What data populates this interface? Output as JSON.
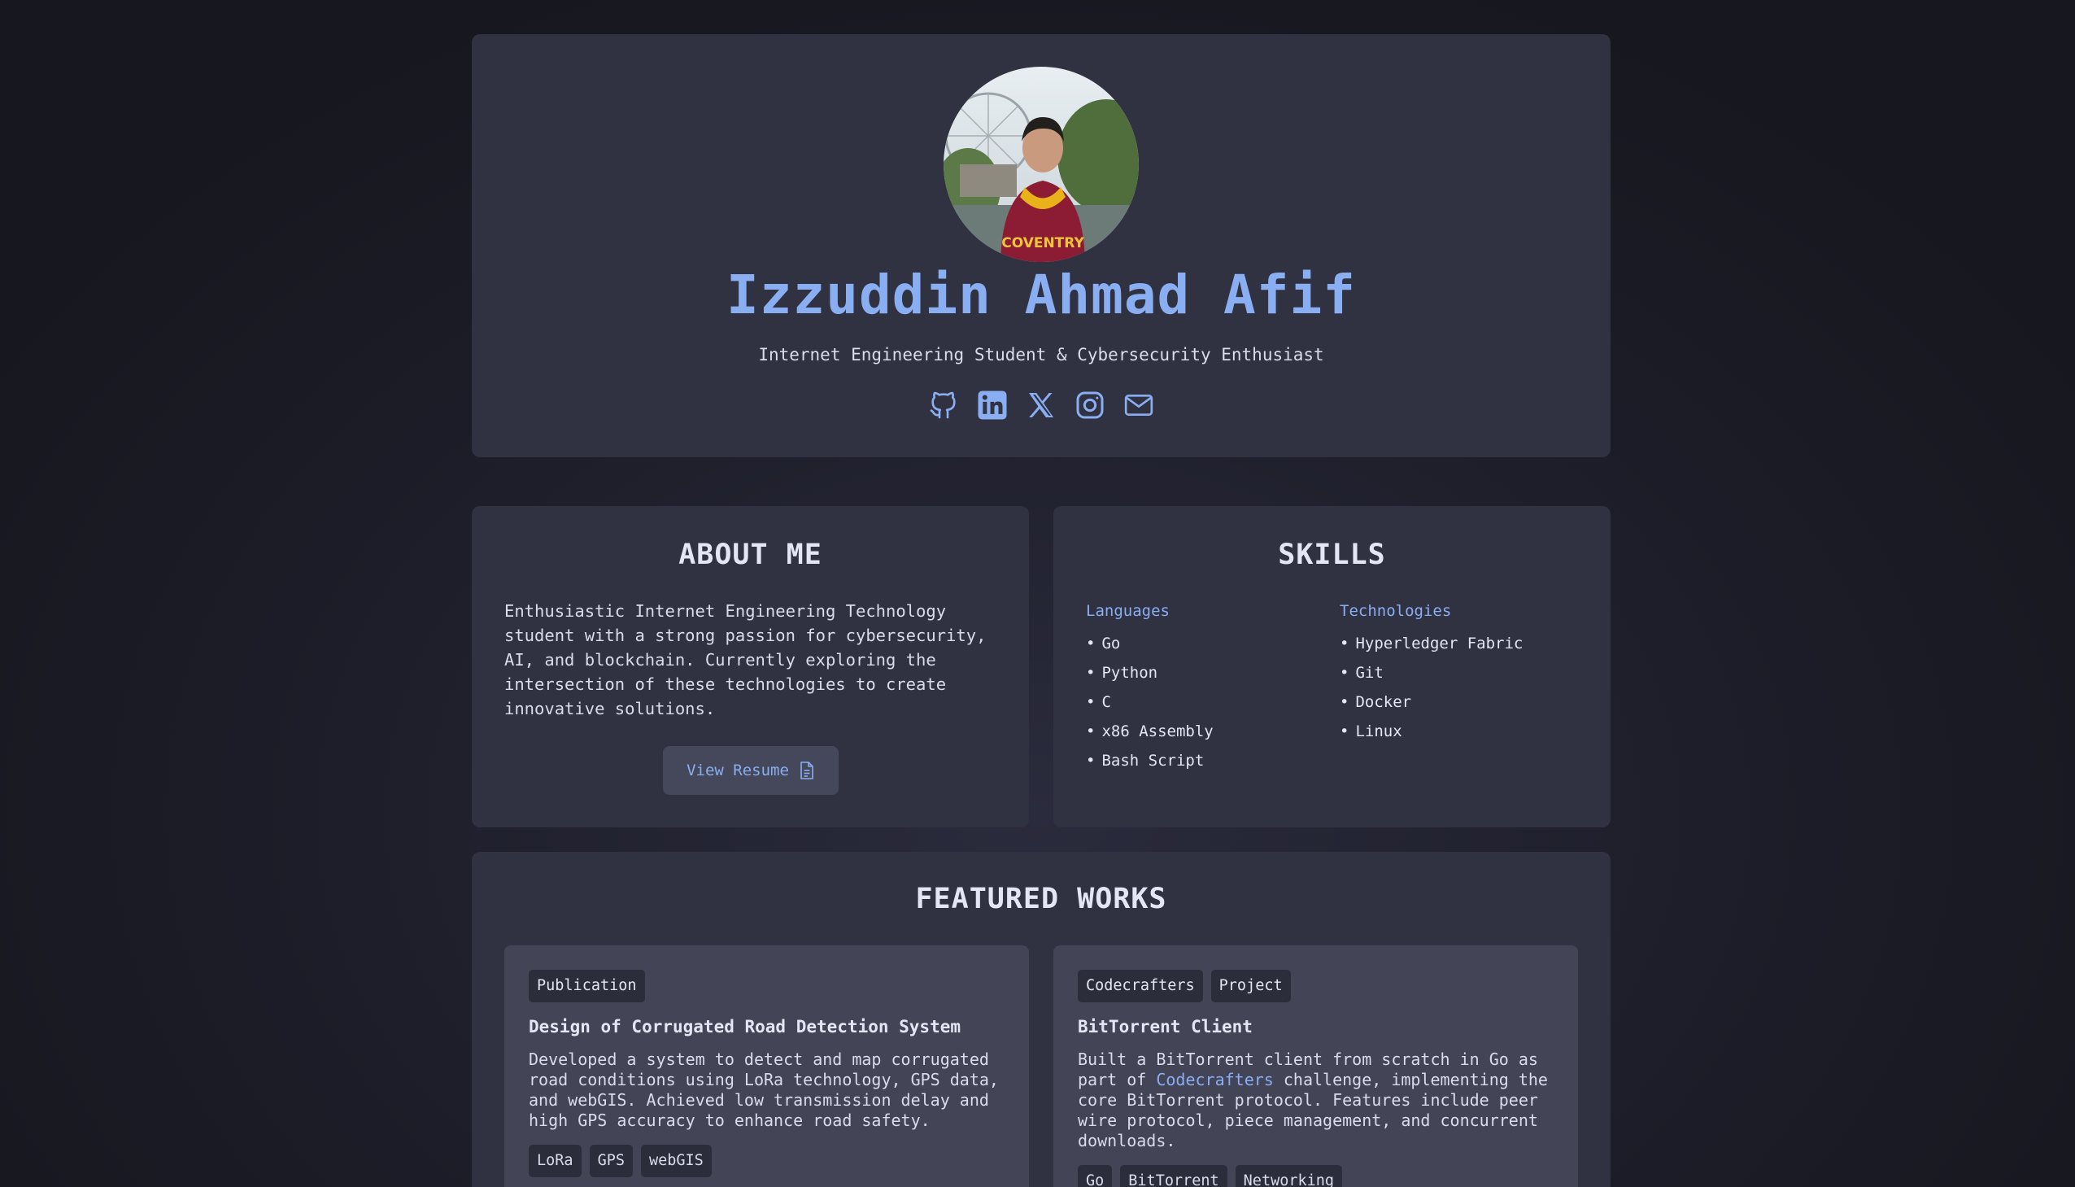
{
  "profile": {
    "name": "Izzuddin Ahmad Afif",
    "tagline": "Internet Engineering Student & Cybersecurity Enthusiast",
    "avatar_text": "COVENTRY",
    "socials": [
      {
        "icon": "github-icon"
      },
      {
        "icon": "linkedin-icon"
      },
      {
        "icon": "x-icon"
      },
      {
        "icon": "instagram-icon"
      },
      {
        "icon": "mail-icon"
      }
    ]
  },
  "about": {
    "title": "ABOUT ME",
    "text": "Enthusiastic Internet Engineering Technology student with a strong passion for cybersecurity, AI, and blockchain. Currently exploring the intersection of these technologies to create innovative solutions.",
    "resume_label": "View Resume"
  },
  "skills": {
    "title": "SKILLS",
    "languages_label": "Languages",
    "languages": [
      "Go",
      "Python",
      "C",
      "x86 Assembly",
      "Bash Script"
    ],
    "technologies_label": "Technologies",
    "technologies": [
      "Hyperledger Fabric",
      "Git",
      "Docker",
      "Linux"
    ]
  },
  "featured": {
    "title": "FEATURED WORKS",
    "works": [
      {
        "chips": [
          "Publication"
        ],
        "title": "Design of Corrugated Road Detection System",
        "desc": "Developed a system to detect and map corrugated road conditions using LoRa technology, GPS data, and webGIS. Achieved low transmission delay and high GPS accuracy to enhance road safety.",
        "tags": [
          "LoRa",
          "GPS",
          "webGIS"
        ]
      },
      {
        "chips": [
          "Codecrafters",
          "Project"
        ],
        "title": "BitTorrent Client",
        "desc_before": "Built a BitTorrent client from scratch in Go as part of ",
        "desc_link": "Codecrafters",
        "desc_after": " challenge, implementing the core BitTorrent protocol. Features include peer wire protocol, piece management, and concurrent downloads.",
        "tags": [
          "Go",
          "BitTorrent",
          "Networking"
        ]
      }
    ]
  },
  "colors": {
    "accent": "#8aaef2",
    "card": "#303141",
    "inner_card": "#434456",
    "background": "#1b1b26"
  }
}
